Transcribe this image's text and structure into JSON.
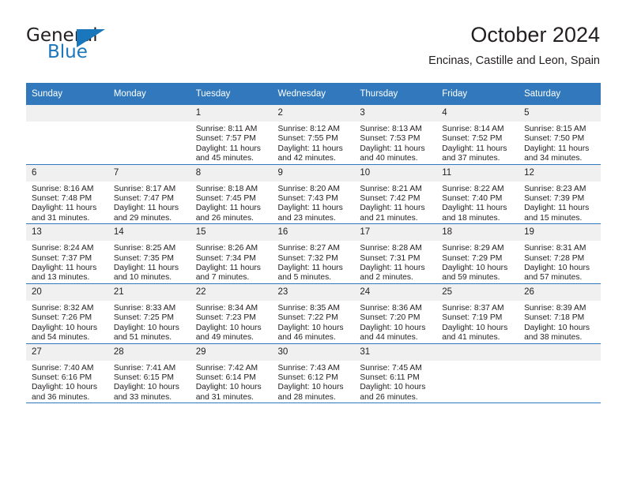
{
  "brand": {
    "name_top": "General",
    "name_bottom": "Blue",
    "accent_color": "#1b77bc"
  },
  "header": {
    "title": "October 2024",
    "location": "Encinas, Castille and Leon, Spain"
  },
  "calendar": {
    "header_color": "#3179bc",
    "daynum_background": "#f0f0f0",
    "weekdays": [
      "Sunday",
      "Monday",
      "Tuesday",
      "Wednesday",
      "Thursday",
      "Friday",
      "Saturday"
    ],
    "weeks": [
      [
        {
          "day": "",
          "sunrise": "",
          "sunset": "",
          "daylight1": "",
          "daylight2": ""
        },
        {
          "day": "",
          "sunrise": "",
          "sunset": "",
          "daylight1": "",
          "daylight2": ""
        },
        {
          "day": "1",
          "sunrise": "Sunrise: 8:11 AM",
          "sunset": "Sunset: 7:57 PM",
          "daylight1": "Daylight: 11 hours",
          "daylight2": "and 45 minutes."
        },
        {
          "day": "2",
          "sunrise": "Sunrise: 8:12 AM",
          "sunset": "Sunset: 7:55 PM",
          "daylight1": "Daylight: 11 hours",
          "daylight2": "and 42 minutes."
        },
        {
          "day": "3",
          "sunrise": "Sunrise: 8:13 AM",
          "sunset": "Sunset: 7:53 PM",
          "daylight1": "Daylight: 11 hours",
          "daylight2": "and 40 minutes."
        },
        {
          "day": "4",
          "sunrise": "Sunrise: 8:14 AM",
          "sunset": "Sunset: 7:52 PM",
          "daylight1": "Daylight: 11 hours",
          "daylight2": "and 37 minutes."
        },
        {
          "day": "5",
          "sunrise": "Sunrise: 8:15 AM",
          "sunset": "Sunset: 7:50 PM",
          "daylight1": "Daylight: 11 hours",
          "daylight2": "and 34 minutes."
        }
      ],
      [
        {
          "day": "6",
          "sunrise": "Sunrise: 8:16 AM",
          "sunset": "Sunset: 7:48 PM",
          "daylight1": "Daylight: 11 hours",
          "daylight2": "and 31 minutes."
        },
        {
          "day": "7",
          "sunrise": "Sunrise: 8:17 AM",
          "sunset": "Sunset: 7:47 PM",
          "daylight1": "Daylight: 11 hours",
          "daylight2": "and 29 minutes."
        },
        {
          "day": "8",
          "sunrise": "Sunrise: 8:18 AM",
          "sunset": "Sunset: 7:45 PM",
          "daylight1": "Daylight: 11 hours",
          "daylight2": "and 26 minutes."
        },
        {
          "day": "9",
          "sunrise": "Sunrise: 8:20 AM",
          "sunset": "Sunset: 7:43 PM",
          "daylight1": "Daylight: 11 hours",
          "daylight2": "and 23 minutes."
        },
        {
          "day": "10",
          "sunrise": "Sunrise: 8:21 AM",
          "sunset": "Sunset: 7:42 PM",
          "daylight1": "Daylight: 11 hours",
          "daylight2": "and 21 minutes."
        },
        {
          "day": "11",
          "sunrise": "Sunrise: 8:22 AM",
          "sunset": "Sunset: 7:40 PM",
          "daylight1": "Daylight: 11 hours",
          "daylight2": "and 18 minutes."
        },
        {
          "day": "12",
          "sunrise": "Sunrise: 8:23 AM",
          "sunset": "Sunset: 7:39 PM",
          "daylight1": "Daylight: 11 hours",
          "daylight2": "and 15 minutes."
        }
      ],
      [
        {
          "day": "13",
          "sunrise": "Sunrise: 8:24 AM",
          "sunset": "Sunset: 7:37 PM",
          "daylight1": "Daylight: 11 hours",
          "daylight2": "and 13 minutes."
        },
        {
          "day": "14",
          "sunrise": "Sunrise: 8:25 AM",
          "sunset": "Sunset: 7:35 PM",
          "daylight1": "Daylight: 11 hours",
          "daylight2": "and 10 minutes."
        },
        {
          "day": "15",
          "sunrise": "Sunrise: 8:26 AM",
          "sunset": "Sunset: 7:34 PM",
          "daylight1": "Daylight: 11 hours",
          "daylight2": "and 7 minutes."
        },
        {
          "day": "16",
          "sunrise": "Sunrise: 8:27 AM",
          "sunset": "Sunset: 7:32 PM",
          "daylight1": "Daylight: 11 hours",
          "daylight2": "and 5 minutes."
        },
        {
          "day": "17",
          "sunrise": "Sunrise: 8:28 AM",
          "sunset": "Sunset: 7:31 PM",
          "daylight1": "Daylight: 11 hours",
          "daylight2": "and 2 minutes."
        },
        {
          "day": "18",
          "sunrise": "Sunrise: 8:29 AM",
          "sunset": "Sunset: 7:29 PM",
          "daylight1": "Daylight: 10 hours",
          "daylight2": "and 59 minutes."
        },
        {
          "day": "19",
          "sunrise": "Sunrise: 8:31 AM",
          "sunset": "Sunset: 7:28 PM",
          "daylight1": "Daylight: 10 hours",
          "daylight2": "and 57 minutes."
        }
      ],
      [
        {
          "day": "20",
          "sunrise": "Sunrise: 8:32 AM",
          "sunset": "Sunset: 7:26 PM",
          "daylight1": "Daylight: 10 hours",
          "daylight2": "and 54 minutes."
        },
        {
          "day": "21",
          "sunrise": "Sunrise: 8:33 AM",
          "sunset": "Sunset: 7:25 PM",
          "daylight1": "Daylight: 10 hours",
          "daylight2": "and 51 minutes."
        },
        {
          "day": "22",
          "sunrise": "Sunrise: 8:34 AM",
          "sunset": "Sunset: 7:23 PM",
          "daylight1": "Daylight: 10 hours",
          "daylight2": "and 49 minutes."
        },
        {
          "day": "23",
          "sunrise": "Sunrise: 8:35 AM",
          "sunset": "Sunset: 7:22 PM",
          "daylight1": "Daylight: 10 hours",
          "daylight2": "and 46 minutes."
        },
        {
          "day": "24",
          "sunrise": "Sunrise: 8:36 AM",
          "sunset": "Sunset: 7:20 PM",
          "daylight1": "Daylight: 10 hours",
          "daylight2": "and 44 minutes."
        },
        {
          "day": "25",
          "sunrise": "Sunrise: 8:37 AM",
          "sunset": "Sunset: 7:19 PM",
          "daylight1": "Daylight: 10 hours",
          "daylight2": "and 41 minutes."
        },
        {
          "day": "26",
          "sunrise": "Sunrise: 8:39 AM",
          "sunset": "Sunset: 7:18 PM",
          "daylight1": "Daylight: 10 hours",
          "daylight2": "and 38 minutes."
        }
      ],
      [
        {
          "day": "27",
          "sunrise": "Sunrise: 7:40 AM",
          "sunset": "Sunset: 6:16 PM",
          "daylight1": "Daylight: 10 hours",
          "daylight2": "and 36 minutes."
        },
        {
          "day": "28",
          "sunrise": "Sunrise: 7:41 AM",
          "sunset": "Sunset: 6:15 PM",
          "daylight1": "Daylight: 10 hours",
          "daylight2": "and 33 minutes."
        },
        {
          "day": "29",
          "sunrise": "Sunrise: 7:42 AM",
          "sunset": "Sunset: 6:14 PM",
          "daylight1": "Daylight: 10 hours",
          "daylight2": "and 31 minutes."
        },
        {
          "day": "30",
          "sunrise": "Sunrise: 7:43 AM",
          "sunset": "Sunset: 6:12 PM",
          "daylight1": "Daylight: 10 hours",
          "daylight2": "and 28 minutes."
        },
        {
          "day": "31",
          "sunrise": "Sunrise: 7:45 AM",
          "sunset": "Sunset: 6:11 PM",
          "daylight1": "Daylight: 10 hours",
          "daylight2": "and 26 minutes."
        },
        {
          "day": "",
          "sunrise": "",
          "sunset": "",
          "daylight1": "",
          "daylight2": ""
        },
        {
          "day": "",
          "sunrise": "",
          "sunset": "",
          "daylight1": "",
          "daylight2": ""
        }
      ]
    ]
  }
}
